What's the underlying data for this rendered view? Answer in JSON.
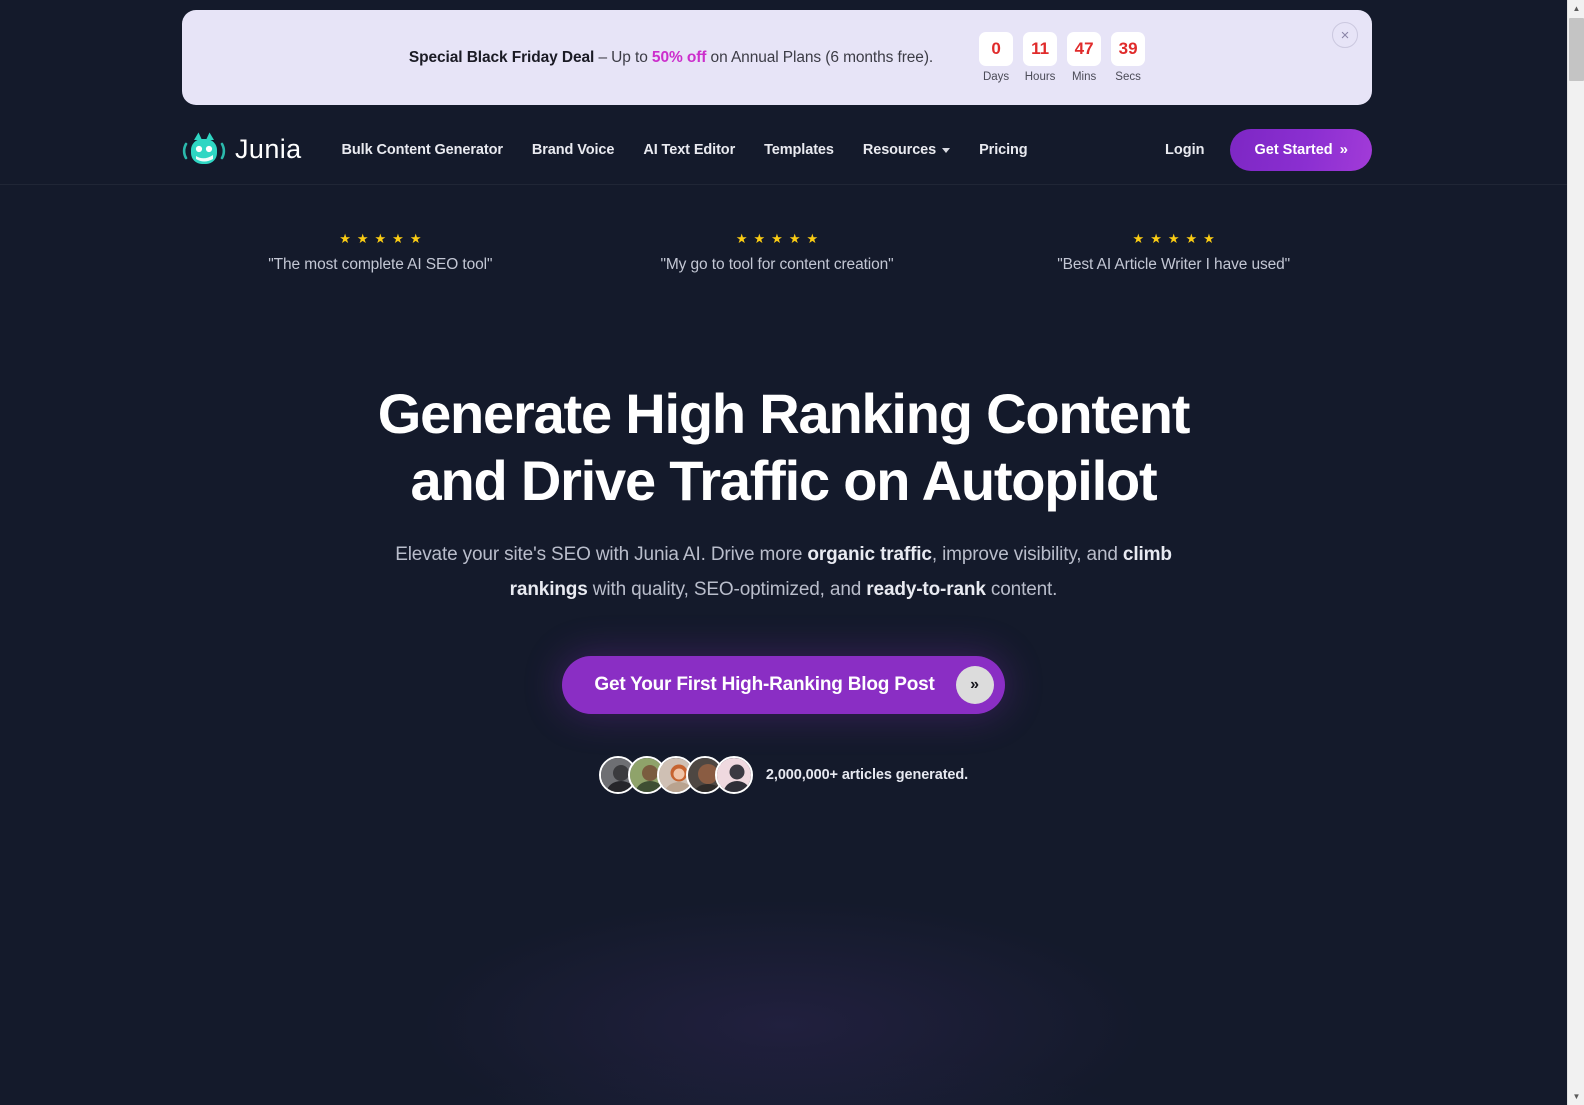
{
  "banner": {
    "lead": "Special Black Friday Deal",
    "dash": " – Up to ",
    "percent": "50% off",
    "tail": " on Annual Plans (6 months free).",
    "close_icon": "×",
    "countdown": [
      {
        "value": "0",
        "label": "Days"
      },
      {
        "value": "11",
        "label": "Hours"
      },
      {
        "value": "47",
        "label": "Mins"
      },
      {
        "value": "39",
        "label": "Secs"
      }
    ],
    "colors": {
      "background": "#e7e4f7",
      "accent": "#cc2ecc",
      "digits": "#e02b2b"
    }
  },
  "nav": {
    "brand": "Junia",
    "links": [
      {
        "label": "Bulk Content Generator",
        "has_chevron": false
      },
      {
        "label": "Brand Voice",
        "has_chevron": false
      },
      {
        "label": "AI Text Editor",
        "has_chevron": false
      },
      {
        "label": "Templates",
        "has_chevron": false
      },
      {
        "label": "Resources",
        "has_chevron": true
      },
      {
        "label": "Pricing",
        "has_chevron": false
      }
    ],
    "login": "Login",
    "cta": "Get Started",
    "cta_icon": "»"
  },
  "testimonials": [
    {
      "stars": 5,
      "quote": "\"The most complete AI SEO tool\""
    },
    {
      "stars": 5,
      "quote": "\"My go to tool for content creation\""
    },
    {
      "stars": 5,
      "quote": "\"Best AI Article Writer I have used\""
    }
  ],
  "hero": {
    "heading_line1": "Generate High Ranking Content",
    "heading_line2": "and Drive Traffic on Autopilot",
    "sub_1": "Elevate your site's SEO with Junia AI. Drive more ",
    "sub_b1": "organic traffic",
    "sub_2": ", improve visibility, and ",
    "sub_b2": "climb rankings",
    "sub_3": " with quality, SEO-optimized, and ",
    "sub_b3": "ready-to-rank",
    "sub_4": " content.",
    "cta_label": "Get Your First High-Ranking Blog Post",
    "cta_icon": "»",
    "proof_text": "2,000,000+ articles generated.",
    "avatar_count": 5
  },
  "scrollbar": {
    "up_arrow": "▲",
    "down_arrow": "▼"
  },
  "colors": {
    "page_background": "#141a2b",
    "purple": "#8a2ec4",
    "star": "#facc14",
    "brand_teal": "#2fd6c3"
  }
}
